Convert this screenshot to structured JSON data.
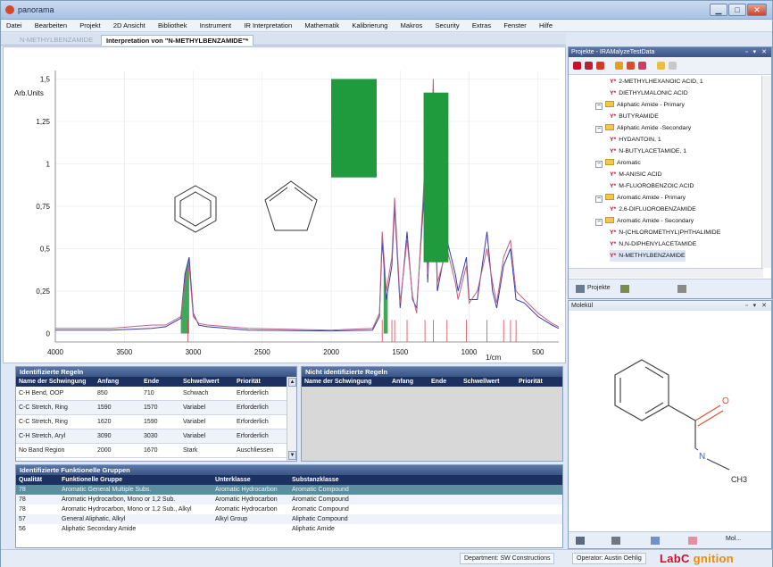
{
  "app": {
    "title": "panorama"
  },
  "window_buttons": {
    "minimize": "▁",
    "maximize": "□",
    "close": "✕"
  },
  "menu": [
    "Datei",
    "Bearbeiten",
    "Projekt",
    "2D Ansicht",
    "Bibliothek",
    "Instrument",
    "IR Interpretation",
    "Mathematik",
    "Kalibrierung",
    "Makros",
    "Security",
    "Extras",
    "Fenster",
    "Hilfe"
  ],
  "doc_tabs": {
    "inactive": "N-METHYLBENZAMIDE",
    "active": "Interpretation von \"N-METHYLBENZAMIDE\"*"
  },
  "chart_data": {
    "type": "line",
    "ylabel": "Arb.Units",
    "xlabel": "1/cm",
    "xlim": [
      4000,
      350
    ],
    "ylim": [
      -0.05,
      1.55
    ],
    "x_ticks": [
      4000,
      3500,
      3000,
      2500,
      2000,
      1500,
      1000,
      500
    ],
    "y_ticks": [
      "0",
      "0,25",
      "0,5",
      "0,75",
      "1",
      "1,25",
      "1,5"
    ],
    "y_tick_values": [
      0,
      0.25,
      0.5,
      0.75,
      1,
      1.25,
      1.5
    ],
    "grid": true,
    "series": [
      {
        "color": "#3a3ab0",
        "values": [
          [
            4000,
            0.02
          ],
          [
            3600,
            0.02
          ],
          [
            3300,
            0.03
          ],
          [
            3200,
            0.04
          ],
          [
            3090,
            0.09
          ],
          [
            3060,
            0.35
          ],
          [
            3030,
            0.45
          ],
          [
            3000,
            0.12
          ],
          [
            2960,
            0.05
          ],
          [
            2900,
            0.04
          ],
          [
            2600,
            0.02
          ],
          [
            2000,
            0.015
          ],
          [
            1700,
            0.02
          ],
          [
            1650,
            0.1
          ],
          [
            1630,
            0.55
          ],
          [
            1600,
            0.2
          ],
          [
            1560,
            0.4
          ],
          [
            1540,
            0.75
          ],
          [
            1500,
            0.15
          ],
          [
            1450,
            0.6
          ],
          [
            1410,
            0.2
          ],
          [
            1380,
            0.15
          ],
          [
            1320,
            0.9
          ],
          [
            1300,
            0.3
          ],
          [
            1260,
            1.15
          ],
          [
            1230,
            0.25
          ],
          [
            1160,
            0.55
          ],
          [
            1100,
            0.35
          ],
          [
            1080,
            0.25
          ],
          [
            1020,
            0.45
          ],
          [
            1000,
            0.2
          ],
          [
            940,
            0.2
          ],
          [
            870,
            0.6
          ],
          [
            830,
            0.25
          ],
          [
            800,
            0.15
          ],
          [
            750,
            0.4
          ],
          [
            700,
            0.5
          ],
          [
            660,
            0.2
          ],
          [
            600,
            0.18
          ],
          [
            500,
            0.1
          ],
          [
            400,
            0.05
          ],
          [
            350,
            0.03
          ]
        ]
      },
      {
        "color": "#c06080",
        "values": [
          [
            4000,
            0.03
          ],
          [
            3600,
            0.03
          ],
          [
            3300,
            0.05
          ],
          [
            3200,
            0.05
          ],
          [
            3090,
            0.1
          ],
          [
            3060,
            0.3
          ],
          [
            3030,
            0.4
          ],
          [
            3000,
            0.1
          ],
          [
            2960,
            0.06
          ],
          [
            2900,
            0.05
          ],
          [
            2600,
            0.03
          ],
          [
            2000,
            0.02
          ],
          [
            1700,
            0.03
          ],
          [
            1650,
            0.12
          ],
          [
            1630,
            0.6
          ],
          [
            1600,
            0.25
          ],
          [
            1560,
            0.45
          ],
          [
            1540,
            0.8
          ],
          [
            1500,
            0.18
          ],
          [
            1450,
            0.55
          ],
          [
            1410,
            0.22
          ],
          [
            1380,
            0.12
          ],
          [
            1320,
            1.0
          ],
          [
            1300,
            0.35
          ],
          [
            1260,
            1.5
          ],
          [
            1230,
            0.3
          ],
          [
            1160,
            0.5
          ],
          [
            1100,
            0.3
          ],
          [
            1080,
            0.2
          ],
          [
            1020,
            0.4
          ],
          [
            1000,
            0.18
          ],
          [
            940,
            0.25
          ],
          [
            870,
            0.5
          ],
          [
            830,
            0.3
          ],
          [
            800,
            0.18
          ],
          [
            750,
            0.45
          ],
          [
            700,
            0.55
          ],
          [
            660,
            0.25
          ],
          [
            600,
            0.2
          ],
          [
            500,
            0.12
          ],
          [
            400,
            0.06
          ],
          [
            350,
            0.04
          ]
        ]
      }
    ],
    "filled_regions": [
      {
        "color": "#1f9a3c",
        "xmin": 3090,
        "xmax": 3030
      },
      {
        "color": "#1f9a3c",
        "xmin": 1620,
        "xmax": 1590
      }
    ],
    "rule_boxes": [
      {
        "color": "#1f9a3c",
        "xmin": 2000,
        "xmax": 1670,
        "ymin": 0.92,
        "ymax": 1.5
      },
      {
        "color": "#1f9a3c",
        "xmin": 1330,
        "xmax": 1150,
        "ymin": 0.42,
        "ymax": 1.42
      }
    ],
    "reference_lines": {
      "color": "#e04050",
      "x": [
        3040,
        1630,
        1560,
        1540,
        1450,
        1320,
        1260,
        1160,
        1020,
        870,
        750,
        700,
        660
      ]
    }
  },
  "identified": {
    "title": "Identifizierte Regeln",
    "columns": [
      "Name der Schwingung",
      "Anfang",
      "Ende",
      "Schwellwert",
      "Priorität"
    ],
    "rows": [
      [
        "C-H Bend, OOP",
        "850",
        "710",
        "Schwach",
        "Erforderlich"
      ],
      [
        "C-C Stretch, Ring",
        "1590",
        "1570",
        "Variabel",
        "Erforderlich"
      ],
      [
        "C-C Stretch, Ring",
        "1620",
        "1590",
        "Variabel",
        "Erforderlich"
      ],
      [
        "C-H Stretch, Aryl",
        "3090",
        "3030",
        "Variabel",
        "Erforderlich"
      ],
      [
        "No Band Region",
        "2000",
        "1670",
        "Stark",
        "Auschliessen"
      ]
    ]
  },
  "not_identified": {
    "title": "Nicht identifizierte Regeln",
    "columns": [
      "Name der Schwingung",
      "Anfang",
      "Ende",
      "Schwellwert",
      "Priorität"
    ]
  },
  "groups": {
    "title": "Identifizierte Funktionelle Gruppen",
    "columns": [
      "Qualität",
      "Funktionelle Gruppe",
      "Unterklasse",
      "Substanzklasse"
    ],
    "rows": [
      [
        "78",
        "Aromatic General Multiple Subs.",
        "Aromatic Hydrocarbon",
        "Aromatic Compound"
      ],
      [
        "78",
        "Aromatic Hydrocarbon, Mono or 1,2 Sub.",
        "Aromatic Hydrocarbon",
        "Aromatic Compound"
      ],
      [
        "78",
        "Aromatic Hydrocarbon, Mono or 1,2 Sub., Alkyl",
        "Aromatic Hydrocarbon",
        "Aromatic Compound"
      ],
      [
        "57",
        "General Aliphatic, Alkyl",
        "Alkyl Group",
        "Aliphatic Compound"
      ],
      [
        "56",
        "Aliphatic Secondary Amide",
        "",
        "Aliphatic Amide"
      ]
    ]
  },
  "projects": {
    "title": "Projekte - IRAMalyzeTestData",
    "tree": [
      {
        "type": "mol",
        "label": "2-METHYLHEXANOIC ACID, 1"
      },
      {
        "type": "mol",
        "label": "DIETHYLMALONIC ACID"
      },
      {
        "type": "folder",
        "label": "Aliphatic Amide - Primary"
      },
      {
        "type": "mol",
        "label": "BUTYRAMIDE"
      },
      {
        "type": "folder",
        "label": "Aliphatic Amide -Secondary"
      },
      {
        "type": "mol",
        "label": "HYDANTOIN, 1"
      },
      {
        "type": "mol",
        "label": "N-BUTYLACETAMIDE, 1"
      },
      {
        "type": "folder",
        "label": "Aromatic"
      },
      {
        "type": "mol",
        "label": "M-ANISIC ACID"
      },
      {
        "type": "mol",
        "label": "M-FLUOROBENZOIC ACID"
      },
      {
        "type": "folder",
        "label": "Aromatic Amide - Primary"
      },
      {
        "type": "mol",
        "label": "2,6-DIFLUOROBENZAMIDE"
      },
      {
        "type": "folder",
        "label": "Aromatic Amide - Secondary"
      },
      {
        "type": "mol",
        "label": "N-(CHLOROMETHYL)PHTHALIMIDE"
      },
      {
        "type": "mol",
        "label": "N,N-DIPHENYLACETAMIDE"
      },
      {
        "type": "mol",
        "label": "N-METHYLBENZAMIDE"
      }
    ],
    "bottom_tab": "Projekte",
    "dock_controls": "▫ ▾ ✕",
    "mol_icon_glyph": "Y*"
  },
  "molecule": {
    "title": "Molekül",
    "atoms": {
      "o": "O",
      "n": "N",
      "ch3": "CH3"
    },
    "bottom_label": "Mol..."
  },
  "status": {
    "department": "Department: SW Constructions",
    "operator": "Operator: Austin Oehlig"
  },
  "logo": {
    "part1": "LabC",
    "part2": "gnition"
  },
  "colors": {
    "accent": "#3a5484",
    "highlight": "#5a8fa0",
    "rule_box": "#1f9a3c",
    "logo_red": "#c8102e",
    "logo_orange": "#f28a00"
  }
}
